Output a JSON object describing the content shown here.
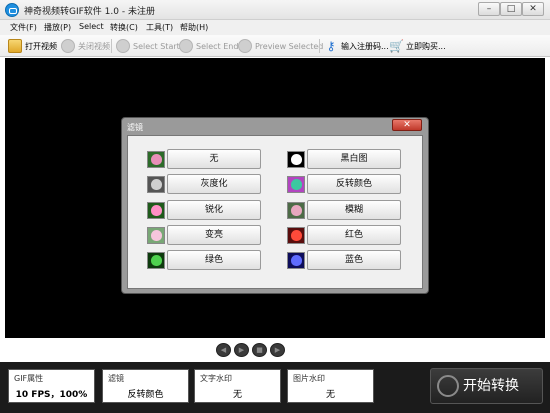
{
  "window": {
    "title": "神奇视频转GIF软件 1.0 - 未注册"
  },
  "menu": [
    {
      "label": "文件(F)"
    },
    {
      "label": "播放(P)"
    },
    {
      "label": "Select"
    },
    {
      "label": "转换(C)"
    },
    {
      "label": "工具(T)"
    },
    {
      "label": "帮助(H)"
    }
  ],
  "toolbar": {
    "open_video": "打开视频",
    "close_video": "关闭视频",
    "select_start": "Select Start",
    "select_end": "Select End",
    "preview_selected": "Preview Selected",
    "register": "输入注册码...",
    "buy": "立即购买..."
  },
  "dialog": {
    "title": "滤镜",
    "filters_left": [
      {
        "label": "无",
        "thumb_color": "#e88fb8",
        "thumb_bg": "#2d6b2a"
      },
      {
        "label": "灰度化",
        "thumb_color": "#cfcfcf",
        "thumb_bg": "#555555"
      },
      {
        "label": "锐化",
        "thumb_color": "#ff8fc5",
        "thumb_bg": "#1f5a1b"
      },
      {
        "label": "变亮",
        "thumb_color": "#f6c6dc",
        "thumb_bg": "#79a776"
      },
      {
        "label": "绿色",
        "thumb_color": "#4fd14f",
        "thumb_bg": "#0d3a0d"
      }
    ],
    "filters_right": [
      {
        "label": "黑白图",
        "thumb_color": "#ffffff",
        "thumb_bg": "#000000"
      },
      {
        "label": "反转颜色",
        "thumb_color": "#3cc8a0",
        "thumb_bg": "#b245c0"
      },
      {
        "label": "模糊",
        "thumb_color": "#e8a7bf",
        "thumb_bg": "#4d6b47"
      },
      {
        "label": "红色",
        "thumb_color": "#ff4a3a",
        "thumb_bg": "#5a0d0d"
      },
      {
        "label": "蓝色",
        "thumb_color": "#5f6cff",
        "thumb_bg": "#0d0d5a"
      }
    ]
  },
  "bottom": {
    "gif_props": {
      "label": "GIF属性",
      "value": "10 FPS，100%"
    },
    "filter": {
      "label": "滤镜",
      "value": "反转颜色"
    },
    "text_watermark": {
      "label": "文字水印",
      "value": "无"
    },
    "image_watermark": {
      "label": "图片水印",
      "value": "无"
    },
    "start_button": "开始转换"
  }
}
